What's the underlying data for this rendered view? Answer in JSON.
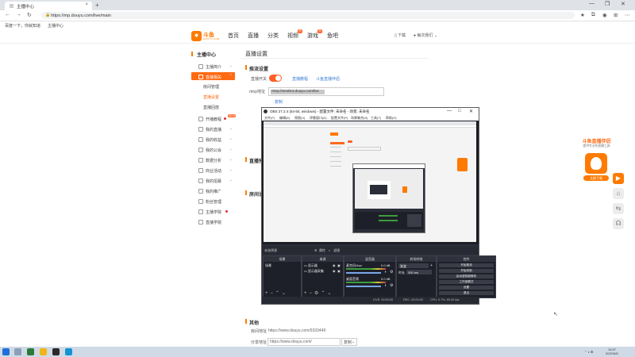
{
  "browser": {
    "tab_title": "主播中心",
    "tab_close": "×",
    "new_tab": "+",
    "address": "https://mp.douyu.com/live/main",
    "window_buttons": [
      "—",
      "❐",
      "✕"
    ],
    "bookmarks": [
      "百度一下，你就知道",
      "主播中心"
    ]
  },
  "site": {
    "logo_text": "斗鱼",
    "logo_sub": "DOUYU.COM",
    "nav": [
      "首页",
      "直播",
      "分类",
      "视频",
      "游戏",
      "鱼吧"
    ],
    "hot_badge": "热",
    "download": "下载",
    "user": "每次我们"
  },
  "sidebar": {
    "title": "主播中心",
    "items": [
      {
        "label": "主播简介"
      },
      {
        "label": "直播相关",
        "active": true
      },
      {
        "label": "开播教程"
      },
      {
        "label": "我的直播"
      },
      {
        "label": "我的收益"
      },
      {
        "label": "我的公会"
      },
      {
        "label": "数据分析"
      },
      {
        "label": "商业活动"
      },
      {
        "label": "我的招募"
      },
      {
        "label": "我的推广"
      },
      {
        "label": "粉丝管理"
      },
      {
        "label": "主播学院"
      },
      {
        "label": "直播学院"
      }
    ],
    "sub_items": [
      "房间管理",
      "直播设置",
      "直播回放"
    ],
    "new_badge": "NEW"
  },
  "content": {
    "page_title": "直播设置",
    "section_stream": "推流设置",
    "live_switch_label": "直播开关",
    "link_tutorial": "直播教程",
    "link_tool": "斗鱼直播伴侣",
    "rtmp_label": "rtmp地址",
    "rtmp_value": "rtmp://sendtc3.douyu.com/live",
    "copy_label": "复制",
    "section_live": "直播预告",
    "section_room": "房间设置",
    "section_other": "其他",
    "room_url_label": "房间地址",
    "room_url": "https://www.douyu.com/9333449",
    "share_url_label": "分享地址",
    "share_url": "https://www.douyu.com/",
    "copy_btn": "复制"
  },
  "obs": {
    "title": "OBS 27.2.4 (64-bit, windows) - 配置文件: 未命名 - 场景: 未命名",
    "menu": [
      "文件(F)",
      "编辑(E)",
      "视图(V)",
      "停靠窗口(D)",
      "配置文件(P)",
      "场景集合(S)",
      "工具(T)",
      "帮助(H)"
    ],
    "scenebar": [
      "未选择源",
      "属性",
      "滤镜"
    ],
    "panels": {
      "scenes": "场景",
      "sources": "来源",
      "mixer": "混音器",
      "transitions": "转场特效",
      "controls": "控件"
    },
    "scene_item": "场景",
    "sources": [
      "显示器",
      "显示器采集"
    ],
    "mixer": [
      {
        "name": "麦克风/Aux",
        "db": "0.0 dB"
      },
      {
        "name": "桌面音频",
        "db": "0.0 dB"
      }
    ],
    "transition": "渐变",
    "duration_label": "时长",
    "duration": "300 ms",
    "controls": [
      "开始推流",
      "开始录制",
      "启动虚拟摄像机",
      "工作室模式",
      "设置",
      "退出"
    ],
    "status": [
      "LIVE: 00:00:00",
      "REC: 00:00:00",
      "CPU: 0.7%, 60.00 fps"
    ]
  },
  "promo": {
    "title": "斗鱼直播伴侣",
    "subtitle": "提供专业的直播工具",
    "download": "立即下载"
  },
  "taskbar": {
    "time": "14:07",
    "date": "2022/5/8"
  },
  "colors": {
    "accent": "#ff6a13",
    "link": "#3a7bd5",
    "obs_bg": "#2b2e38"
  }
}
